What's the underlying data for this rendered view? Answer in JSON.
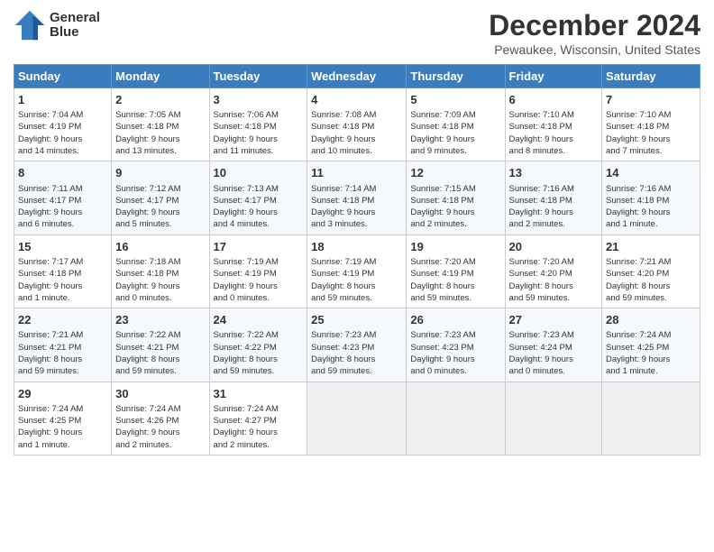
{
  "header": {
    "logo_line1": "General",
    "logo_line2": "Blue",
    "title": "December 2024",
    "subtitle": "Pewaukee, Wisconsin, United States"
  },
  "calendar": {
    "days_of_week": [
      "Sunday",
      "Monday",
      "Tuesday",
      "Wednesday",
      "Thursday",
      "Friday",
      "Saturday"
    ],
    "weeks": [
      [
        null,
        null,
        null,
        null,
        null,
        null,
        null
      ]
    ]
  },
  "cells": {
    "empty": "",
    "w1": [
      {
        "num": "1",
        "info": "Sunrise: 7:04 AM\nSunset: 4:19 PM\nDaylight: 9 hours\nand 14 minutes."
      },
      {
        "num": "2",
        "info": "Sunrise: 7:05 AM\nSunset: 4:18 PM\nDaylight: 9 hours\nand 13 minutes."
      },
      {
        "num": "3",
        "info": "Sunrise: 7:06 AM\nSunset: 4:18 PM\nDaylight: 9 hours\nand 11 minutes."
      },
      {
        "num": "4",
        "info": "Sunrise: 7:08 AM\nSunset: 4:18 PM\nDaylight: 9 hours\nand 10 minutes."
      },
      {
        "num": "5",
        "info": "Sunrise: 7:09 AM\nSunset: 4:18 PM\nDaylight: 9 hours\nand 9 minutes."
      },
      {
        "num": "6",
        "info": "Sunrise: 7:10 AM\nSunset: 4:18 PM\nDaylight: 9 hours\nand 8 minutes."
      },
      {
        "num": "7",
        "info": "Sunrise: 7:10 AM\nSunset: 4:18 PM\nDaylight: 9 hours\nand 7 minutes."
      }
    ],
    "w2": [
      {
        "num": "8",
        "info": "Sunrise: 7:11 AM\nSunset: 4:17 PM\nDaylight: 9 hours\nand 6 minutes."
      },
      {
        "num": "9",
        "info": "Sunrise: 7:12 AM\nSunset: 4:17 PM\nDaylight: 9 hours\nand 5 minutes."
      },
      {
        "num": "10",
        "info": "Sunrise: 7:13 AM\nSunset: 4:17 PM\nDaylight: 9 hours\nand 4 minutes."
      },
      {
        "num": "11",
        "info": "Sunrise: 7:14 AM\nSunset: 4:18 PM\nDaylight: 9 hours\nand 3 minutes."
      },
      {
        "num": "12",
        "info": "Sunrise: 7:15 AM\nSunset: 4:18 PM\nDaylight: 9 hours\nand 2 minutes."
      },
      {
        "num": "13",
        "info": "Sunrise: 7:16 AM\nSunset: 4:18 PM\nDaylight: 9 hours\nand 2 minutes."
      },
      {
        "num": "14",
        "info": "Sunrise: 7:16 AM\nSunset: 4:18 PM\nDaylight: 9 hours\nand 1 minute."
      }
    ],
    "w3": [
      {
        "num": "15",
        "info": "Sunrise: 7:17 AM\nSunset: 4:18 PM\nDaylight: 9 hours\nand 1 minute."
      },
      {
        "num": "16",
        "info": "Sunrise: 7:18 AM\nSunset: 4:18 PM\nDaylight: 9 hours\nand 0 minutes."
      },
      {
        "num": "17",
        "info": "Sunrise: 7:19 AM\nSunset: 4:19 PM\nDaylight: 9 hours\nand 0 minutes."
      },
      {
        "num": "18",
        "info": "Sunrise: 7:19 AM\nSunset: 4:19 PM\nDaylight: 8 hours\nand 59 minutes."
      },
      {
        "num": "19",
        "info": "Sunrise: 7:20 AM\nSunset: 4:19 PM\nDaylight: 8 hours\nand 59 minutes."
      },
      {
        "num": "20",
        "info": "Sunrise: 7:20 AM\nSunset: 4:20 PM\nDaylight: 8 hours\nand 59 minutes."
      },
      {
        "num": "21",
        "info": "Sunrise: 7:21 AM\nSunset: 4:20 PM\nDaylight: 8 hours\nand 59 minutes."
      }
    ],
    "w4": [
      {
        "num": "22",
        "info": "Sunrise: 7:21 AM\nSunset: 4:21 PM\nDaylight: 8 hours\nand 59 minutes."
      },
      {
        "num": "23",
        "info": "Sunrise: 7:22 AM\nSunset: 4:21 PM\nDaylight: 8 hours\nand 59 minutes."
      },
      {
        "num": "24",
        "info": "Sunrise: 7:22 AM\nSunset: 4:22 PM\nDaylight: 8 hours\nand 59 minutes."
      },
      {
        "num": "25",
        "info": "Sunrise: 7:23 AM\nSunset: 4:23 PM\nDaylight: 8 hours\nand 59 minutes."
      },
      {
        "num": "26",
        "info": "Sunrise: 7:23 AM\nSunset: 4:23 PM\nDaylight: 9 hours\nand 0 minutes."
      },
      {
        "num": "27",
        "info": "Sunrise: 7:23 AM\nSunset: 4:24 PM\nDaylight: 9 hours\nand 0 minutes."
      },
      {
        "num": "28",
        "info": "Sunrise: 7:24 AM\nSunset: 4:25 PM\nDaylight: 9 hours\nand 1 minute."
      }
    ],
    "w5": [
      {
        "num": "29",
        "info": "Sunrise: 7:24 AM\nSunset: 4:25 PM\nDaylight: 9 hours\nand 1 minute."
      },
      {
        "num": "30",
        "info": "Sunrise: 7:24 AM\nSunset: 4:26 PM\nDaylight: 9 hours\nand 2 minutes."
      },
      {
        "num": "31",
        "info": "Sunrise: 7:24 AM\nSunset: 4:27 PM\nDaylight: 9 hours\nand 2 minutes."
      },
      null,
      null,
      null,
      null
    ]
  }
}
